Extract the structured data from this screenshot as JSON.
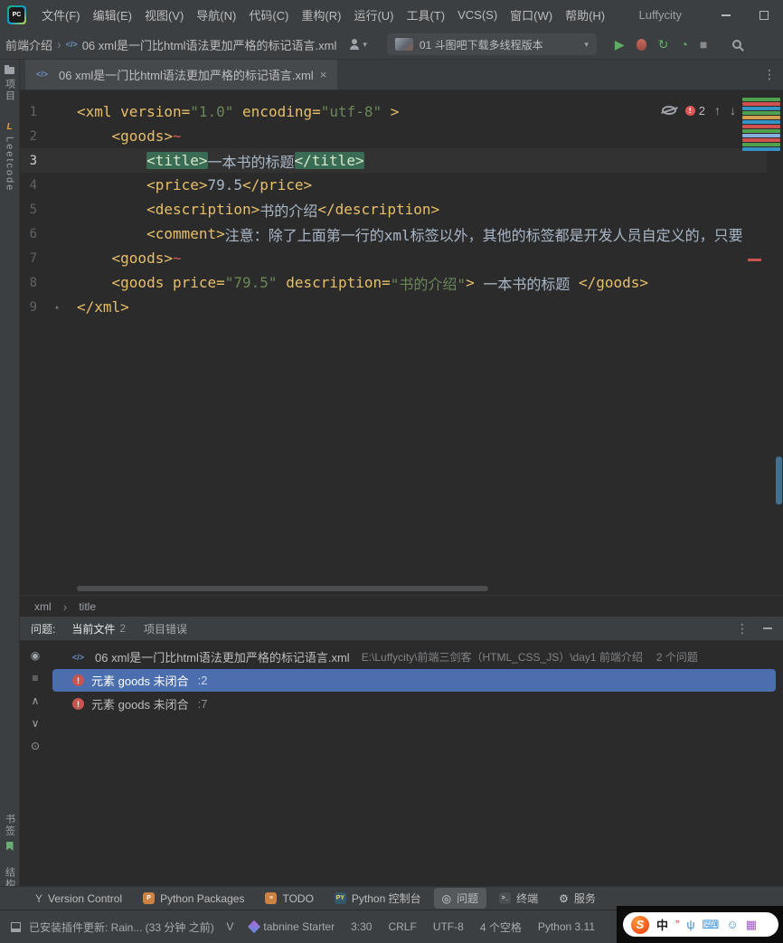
{
  "colors": {
    "tag": "#e8bf6a",
    "string": "#6a8759",
    "plain_text": "#a9b7c6",
    "selection_blue": "#4b6eaf",
    "error_red": "#c75450",
    "run_green": "#5fad65",
    "tag_match_highlight": "#3a6b55"
  },
  "titlebar": {
    "app_icon": "PC",
    "menus": [
      {
        "label": "文件(F)"
      },
      {
        "label": "编辑(E)"
      },
      {
        "label": "视图(V)"
      },
      {
        "label": "导航(N)"
      },
      {
        "label": "代码(C)"
      },
      {
        "label": "重构(R)"
      },
      {
        "label": "运行(U)"
      },
      {
        "label": "工具(T)"
      },
      {
        "label": "VCS(S)"
      },
      {
        "label": "窗口(W)"
      },
      {
        "label": "帮助(H)"
      }
    ],
    "project_name": "Luffycity"
  },
  "toolbar": {
    "breadcrumb_root": "前端介绍",
    "file_name": "06 xml是一门比html语法更加严格的标记语言.xml",
    "run_config": "01 斗图吧下载多线程版本",
    "icons": [
      "run-icon",
      "debug-icon",
      "rerun-icon",
      "profile-icon",
      "stop-icon"
    ]
  },
  "tabbar": {
    "active_tab": "06 xml是一门比html语法更加严格的标记语言.xml"
  },
  "left_stripe": {
    "top": [
      {
        "icon": "folder-icon",
        "label": "项目"
      },
      {
        "icon": "leetcode-icon",
        "label": "Leetcode"
      }
    ],
    "bottom": [
      {
        "icon": "bookmark-icon",
        "label": "书签"
      },
      {
        "icon": "structure-icon",
        "label": "结构"
      }
    ]
  },
  "editor": {
    "inspection": {
      "error_count": "2"
    },
    "lines": [
      {
        "no": "1",
        "segs": [
          {
            "c": "tag",
            "t": "<xml version="
          },
          {
            "c": "str",
            "t": "\"1.0\""
          },
          {
            "c": "tag",
            "t": " encoding="
          },
          {
            "c": "str",
            "t": "\"utf-8\""
          },
          {
            "c": "tag",
            "t": " >"
          }
        ]
      },
      {
        "no": "2",
        "segs": [
          {
            "c": "tag",
            "t": "    <goods>"
          },
          {
            "c": "err",
            "t": "~"
          }
        ]
      },
      {
        "no": "3",
        "caret": true,
        "segs": [
          {
            "c": "txt",
            "t": "        "
          },
          {
            "c": "hl",
            "t": "<title>"
          },
          {
            "c": "txt",
            "t": "一本书的标题"
          },
          {
            "c": "hl",
            "t": "</title>"
          }
        ]
      },
      {
        "no": "4",
        "segs": [
          {
            "c": "tag",
            "t": "        <price>"
          },
          {
            "c": "txt",
            "t": "79.5"
          },
          {
            "c": "tag",
            "t": "</price>"
          }
        ]
      },
      {
        "no": "5",
        "segs": [
          {
            "c": "tag",
            "t": "        <description>"
          },
          {
            "c": "txt",
            "t": "书的介绍"
          },
          {
            "c": "tag",
            "t": "</description>"
          }
        ]
      },
      {
        "no": "6",
        "segs": [
          {
            "c": "tag",
            "t": "        <comment>"
          },
          {
            "c": "txt",
            "t": "注意：除了上面第一行的xml标签以外，其他的标签都是开发人员自定义的，只要"
          }
        ]
      },
      {
        "no": "7",
        "segs": [
          {
            "c": "tag",
            "t": "    <goods>"
          },
          {
            "c": "err",
            "t": "~"
          }
        ]
      },
      {
        "no": "8",
        "segs": [
          {
            "c": "tag",
            "t": "    <goods price="
          },
          {
            "c": "str",
            "t": "\"79.5\""
          },
          {
            "c": "tag",
            "t": " description="
          },
          {
            "c": "str",
            "t": "\"书的介绍\""
          },
          {
            "c": "tag",
            "t": "> "
          },
          {
            "c": "txt",
            "t": "一本书的标题 "
          },
          {
            "c": "tag",
            "t": "</goods>"
          }
        ]
      },
      {
        "no": "9",
        "fold": true,
        "segs": [
          {
            "c": "tag",
            "t": "</xml>"
          }
        ]
      }
    ],
    "stripe_colors": [
      "#4ea24e",
      "#d05050",
      "#3592c4",
      "#4ea24e",
      "#d0a14f",
      "#3592c4",
      "#d05050",
      "#4ea24e",
      "#86afe0",
      "#d05050",
      "#4ea24e",
      "#3592c4"
    ],
    "breadcrumbs": [
      "xml",
      "title"
    ]
  },
  "problems": {
    "panel_title": "问题:",
    "tabs": [
      {
        "label": "当前文件",
        "badge": "2",
        "active": true
      },
      {
        "label": "项目错误",
        "badge": "",
        "active": false
      }
    ],
    "rail_icons": [
      "preview-icon",
      "group-by-icon",
      "expand-all-icon",
      "collapse-all-icon",
      "quickfix-icon"
    ],
    "file_row": {
      "name": "06 xml是一门比html语法更加严格的标记语言.xml",
      "path": "E:\\Luffycity\\前端三剑客（HTML_CSS_JS）\\day1 前端介绍",
      "count": "2 个问题"
    },
    "items": [
      {
        "text": "元素 goods 未闭合",
        "location": ":2",
        "selected": true
      },
      {
        "text": "元素 goods 未闭合",
        "location": ":7",
        "selected": false
      }
    ]
  },
  "bottom_bar": {
    "items": [
      {
        "icon": "branch-icon",
        "label": "Version Control",
        "active": false
      },
      {
        "icon": "packages-icon",
        "label": "Python Packages",
        "active": false
      },
      {
        "icon": "todo-icon",
        "label": "TODO",
        "active": false
      },
      {
        "icon": "py-console-icon",
        "label": "Python 控制台",
        "active": false
      },
      {
        "icon": "problems-icon",
        "label": "问题",
        "active": true
      },
      {
        "icon": "terminal-icon",
        "label": "终端",
        "active": false
      },
      {
        "icon": "services-icon",
        "label": "服务",
        "active": false
      }
    ]
  },
  "status_bar": {
    "left_text": "已安装插件更新: Rain... (33 分钟 之前)",
    "items": [
      {
        "label": "V"
      },
      {
        "icon": "tabnine-icon",
        "label": "tabnine Starter"
      },
      {
        "label": "3:30"
      },
      {
        "label": "CRLF"
      },
      {
        "label": "UTF-8"
      },
      {
        "label": "4 个空格"
      },
      {
        "label": "Python 3.11"
      }
    ]
  },
  "ime_bar": {
    "logo": "S",
    "mode": "中",
    "icons": [
      "quote-icon",
      "mic-icon",
      "keyboard-icon",
      "smiley-icon",
      "grid-icon"
    ]
  }
}
